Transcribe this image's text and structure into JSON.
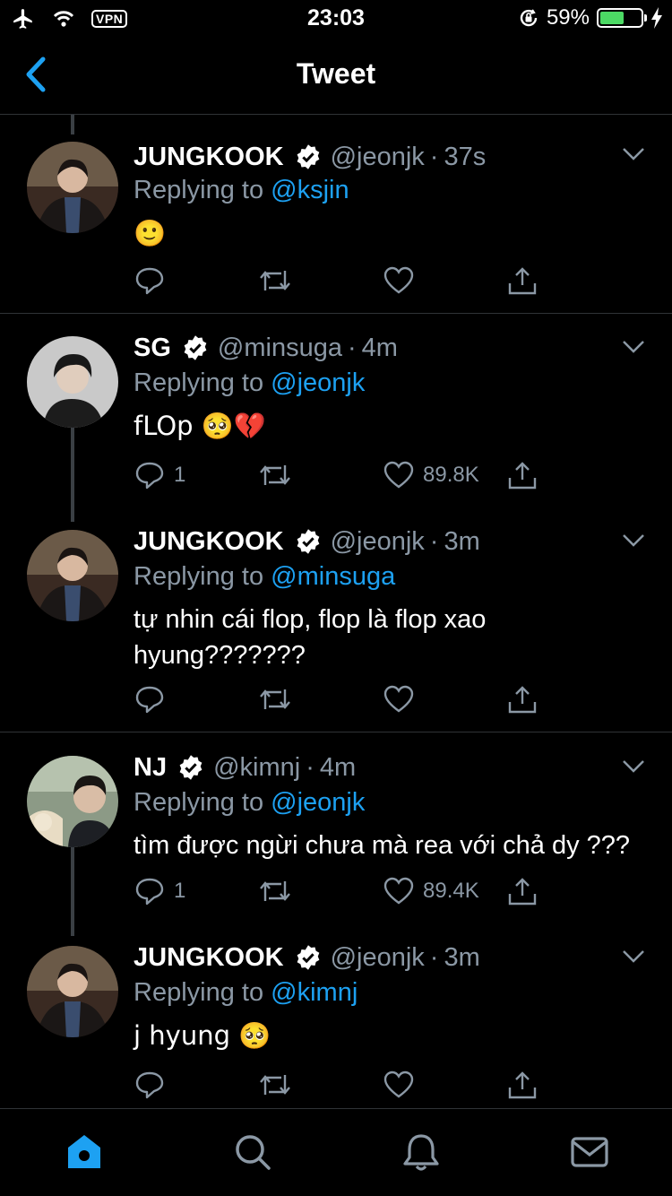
{
  "status_bar": {
    "vpn": "VPN",
    "time": "23:03",
    "battery_percent": "59%",
    "battery_level": 0.59
  },
  "nav": {
    "title": "Tweet"
  },
  "colors": {
    "accent": "#1da1f2",
    "muted": "#8b98a5",
    "background": "#000000",
    "divider": "#2f3336"
  },
  "tweets": [
    {
      "name": "JUNGKOOK",
      "handle": "@jeonjk",
      "time": "37s",
      "replying_label": "Replying to",
      "replying_to": "@ksjin",
      "text": "🙂",
      "reply_count": "",
      "like_count": "",
      "avatar": "avatar-jungkook"
    },
    {
      "name": "SG",
      "handle": "@minsuga",
      "time": "4m",
      "replying_label": "Replying to",
      "replying_to": "@jeonjk",
      "text": "fLOp 🥺💔",
      "reply_count": "1",
      "like_count": "89.8K",
      "avatar": "avatar-sg"
    },
    {
      "name": "JUNGKOOK",
      "handle": "@jeonjk",
      "time": "3m",
      "replying_label": "Replying to",
      "replying_to": "@minsuga",
      "text": "tự nhin cái flop, flop là flop xao hyung???????",
      "reply_count": "",
      "like_count": "",
      "avatar": "avatar-jungkook"
    },
    {
      "name": "NJ",
      "handle": "@kimnj",
      "time": "4m",
      "replying_label": "Replying to",
      "replying_to": "@jeonjk",
      "text": "tìm được ngừi chưa mà rea với chả dy ???",
      "reply_count": "1",
      "like_count": "89.4K",
      "avatar": "avatar-nj"
    },
    {
      "name": "JUNGKOOK",
      "handle": "@jeonjk",
      "time": "3m",
      "replying_label": "Replying to",
      "replying_to": "@kimnj",
      "text": "j hyung 🥺",
      "reply_count": "",
      "like_count": "",
      "avatar": "avatar-jungkook"
    }
  ],
  "tabbar": {
    "items": [
      "home-icon",
      "search-icon",
      "notifications-icon",
      "messages-icon"
    ],
    "active": "home-icon"
  }
}
